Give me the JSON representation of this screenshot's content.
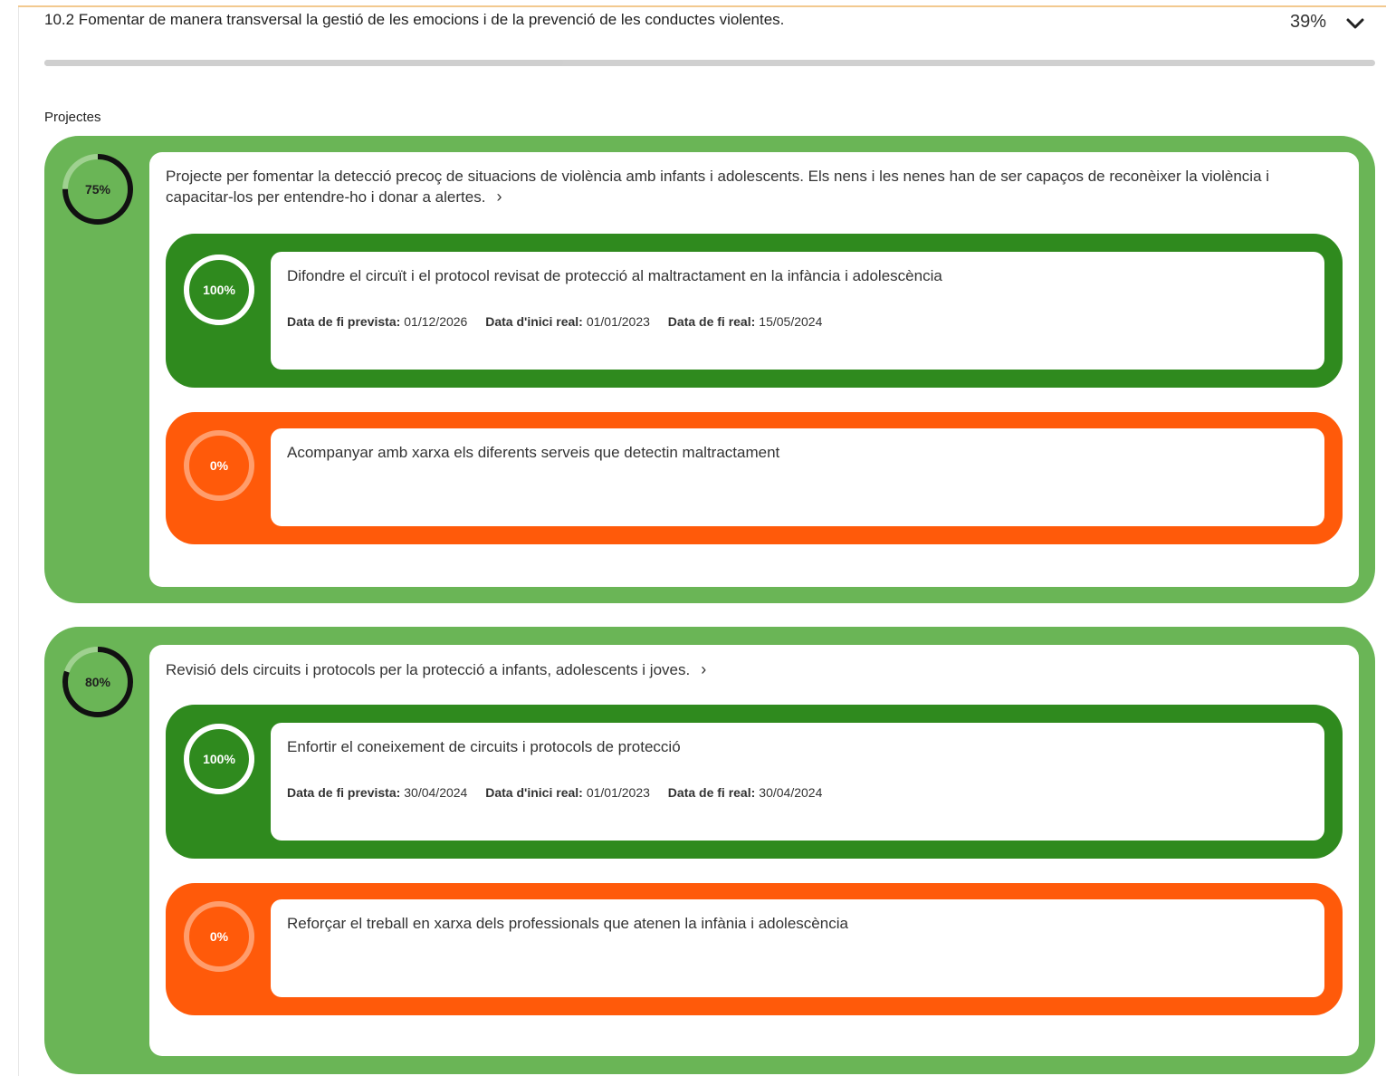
{
  "colors": {
    "done": "#2f8a1e",
    "todo": "#ff5a0a",
    "project": "#6ab556"
  },
  "objective": {
    "title": "10.2 Fomentar de manera transversal la gestió de les emocions i de la prevenció de les conductes violentes.",
    "percent": "39%",
    "progress": 0.39,
    "toggle_icon": "chevron-down-icon"
  },
  "section_label": "Projectes",
  "projects": [
    {
      "percent": "75%",
      "progress": 0.75,
      "title": "Projecte per fomentar la detecció precoç de situacions de violència amb infants i adolescents. Els nens i les nenes han de ser capaços de reconèixer la violència i capacitar-los per entendre-ho i donar a alertes.",
      "arrow_icon": "chevron-right-icon",
      "actions": [
        {
          "status": "done",
          "percent": "100%",
          "progress": 1,
          "title": "Difondre el circuït i el protocol revisat de protecció al maltractament en la infància i adolescència",
          "dates": [
            {
              "label": "Data de fi prevista:",
              "value": "01/12/2026"
            },
            {
              "label": "Data d'inici real:",
              "value": "01/01/2023"
            },
            {
              "label": "Data de fi real:",
              "value": "15/05/2024"
            }
          ]
        },
        {
          "status": "todo",
          "percent": "0%",
          "progress": 0,
          "title": "Acompanyar amb xarxa els diferents serveis que detectin maltractament",
          "dates": []
        }
      ]
    },
    {
      "percent": "80%",
      "progress": 0.8,
      "title": "Revisió dels circuits i protocols per la protecció a infants, adolescents i joves.",
      "arrow_icon": "chevron-right-icon",
      "actions": [
        {
          "status": "done",
          "percent": "100%",
          "progress": 1,
          "title": "Enfortir el coneixement de circuits i protocols de protecció",
          "dates": [
            {
              "label": "Data de fi prevista:",
              "value": "30/04/2024"
            },
            {
              "label": "Data d'inici real:",
              "value": "01/01/2023"
            },
            {
              "label": "Data de fi real:",
              "value": "30/04/2024"
            }
          ]
        },
        {
          "status": "todo",
          "percent": "0%",
          "progress": 0,
          "title": "Reforçar el treball en xarxa dels professionals que atenen la infània i adolescència",
          "dates": []
        }
      ]
    }
  ]
}
